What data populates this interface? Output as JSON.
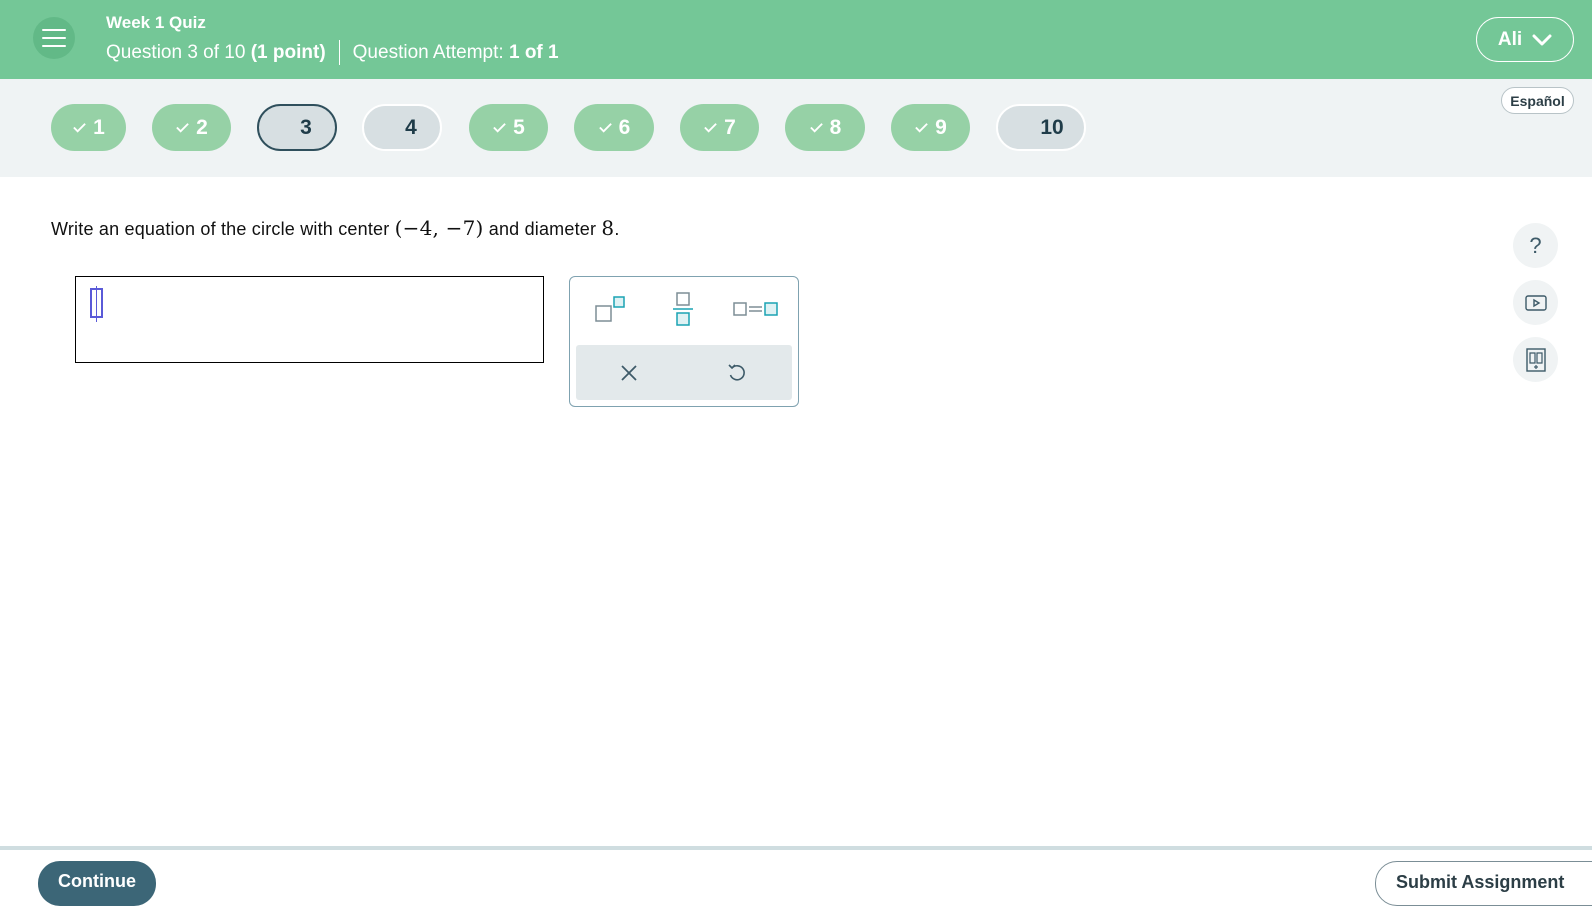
{
  "header": {
    "quiz_title": "Week 1 Quiz",
    "question_position": "Question 3 of 10",
    "points": "(1 point)",
    "attempt_label": "Question Attempt:",
    "attempt_value": "1 of 1",
    "user_name": "Ali",
    "bg_color": "#74c797"
  },
  "nav": {
    "language": "Español",
    "questions": [
      {
        "label": "1",
        "status": "answered"
      },
      {
        "label": "2",
        "status": "answered"
      },
      {
        "label": "3",
        "status": "current"
      },
      {
        "label": "4",
        "status": "unanswered"
      },
      {
        "label": "5",
        "status": "answered"
      },
      {
        "label": "6",
        "status": "answered"
      },
      {
        "label": "7",
        "status": "answered"
      },
      {
        "label": "8",
        "status": "answered"
      },
      {
        "label": "9",
        "status": "answered"
      },
      {
        "label": "10",
        "status": "unanswered"
      }
    ]
  },
  "question": {
    "text_before": "Write an equation of the circle with center ",
    "center": "(−4, −7)",
    "text_middle": " and diameter ",
    "diameter": "8",
    "text_after": "."
  },
  "answer": {
    "value": ""
  },
  "palette": {
    "tools": [
      "exponent-icon",
      "fraction-icon",
      "equals-template-icon"
    ],
    "actions": [
      "clear-icon",
      "undo-icon"
    ]
  },
  "side_tools": {
    "help": "?",
    "icons": [
      "help-icon",
      "video-icon",
      "textbook-icon"
    ]
  },
  "footer": {
    "continue_label": "Continue",
    "submit_label": "Submit Assignment"
  }
}
